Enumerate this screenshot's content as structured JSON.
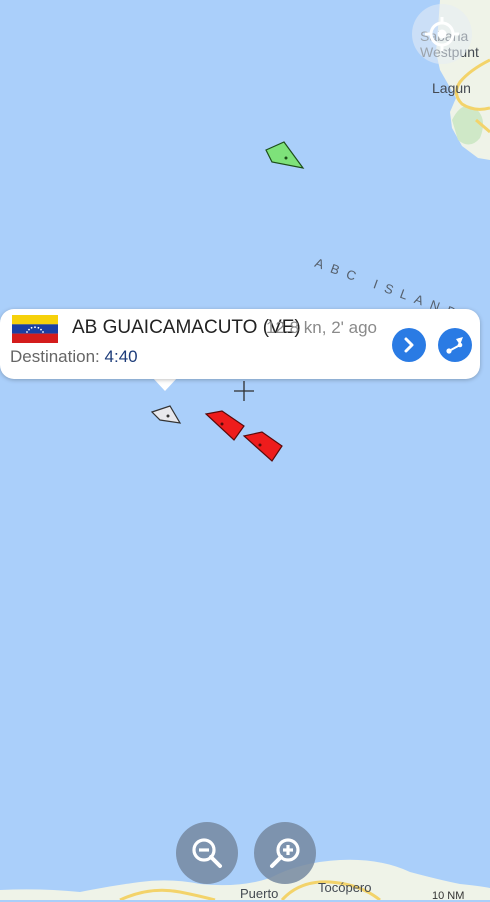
{
  "map": {
    "place_labels": [
      "Sabana Westpunt",
      "Lagun",
      "Puerto",
      "Tocópero"
    ],
    "region_label": "ABC ISLANDS",
    "scale_text": "10 NM",
    "sea_color": "#aacffa"
  },
  "popup": {
    "vessel_name": "AB GUAICAMACUTO (VE)",
    "vessel_meta": "12.8 kn, 2' ago",
    "destination_label": "Destination:",
    "destination_value": "4:40",
    "flag_icon": "venezuela-flag-icon",
    "details_button_icon": "chevron-right-icon",
    "route_button_icon": "route-icon"
  },
  "vessels": [
    {
      "icon": "vessel-marker-green",
      "color": "#7ee27a"
    },
    {
      "icon": "vessel-marker-selected",
      "color": "#e8e8ec"
    },
    {
      "icon": "vessel-marker-red",
      "color": "#ee1c1c"
    },
    {
      "icon": "vessel-marker-red",
      "color": "#ee1c1c"
    }
  ],
  "controls": {
    "locate_icon": "gps-locate-icon",
    "zoom_out_icon": "zoom-out-icon",
    "zoom_in_icon": "zoom-in-icon",
    "crosshair_icon": "crosshair-icon"
  },
  "colors": {
    "accent": "#2a7be4",
    "land": "#eff3e8",
    "road": "#f3d36a"
  }
}
